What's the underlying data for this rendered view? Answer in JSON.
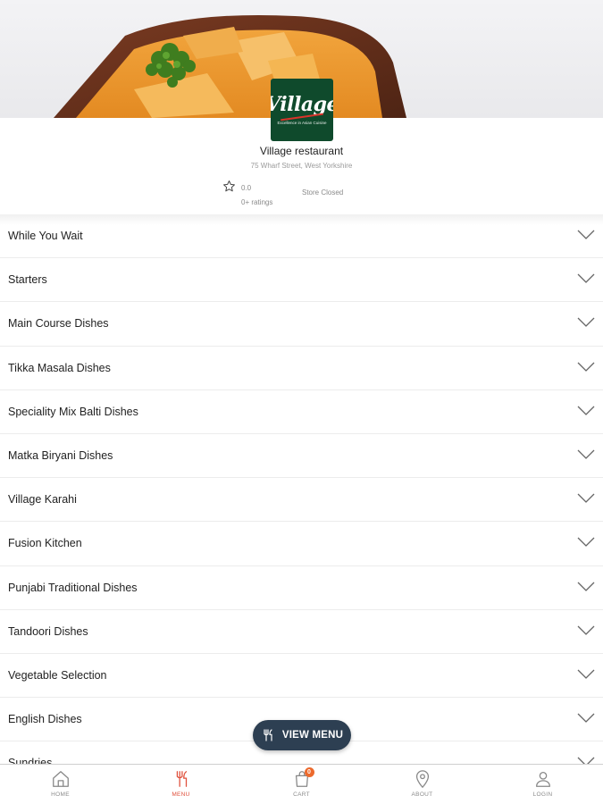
{
  "restaurant": {
    "logo_text": "Village",
    "logo_tagline": "Excellence in Asian Cuisine",
    "name": "Village restaurant",
    "address": "75 Wharf Street, West Yorkshire",
    "rating": "0.0",
    "ratings_count": "0+ ratings",
    "store_status": "Store Closed"
  },
  "menu_categories": [
    {
      "label": "While You Wait"
    },
    {
      "label": "Starters"
    },
    {
      "label": "Main Course Dishes"
    },
    {
      "label": "Tikka Masala Dishes"
    },
    {
      "label": "Speciality Mix Balti Dishes"
    },
    {
      "label": "Matka Biryani Dishes"
    },
    {
      "label": "Village Karahi"
    },
    {
      "label": "Fusion Kitchen"
    },
    {
      "label": "Punjabi Traditional Dishes"
    },
    {
      "label": "Tandoori Dishes"
    },
    {
      "label": "Vegetable Selection"
    },
    {
      "label": "English Dishes"
    },
    {
      "label": "Sundries"
    }
  ],
  "fab": {
    "label": "VIEW MENU"
  },
  "bottom_nav": {
    "items": [
      {
        "label": "HOME",
        "icon": "home-icon"
      },
      {
        "label": "MENU",
        "icon": "cutlery-icon",
        "active": true
      },
      {
        "label": "CART",
        "icon": "shopping-bag-icon",
        "badge": "0"
      },
      {
        "label": "ABOUT",
        "icon": "location-pin-icon"
      },
      {
        "label": "LOGIN",
        "icon": "user-icon"
      }
    ]
  },
  "colors": {
    "accent": "#e0503c",
    "fab_bg": "#2d3f52",
    "badge": "#ec6a2d",
    "logo_bg": "#0f4a2c"
  }
}
